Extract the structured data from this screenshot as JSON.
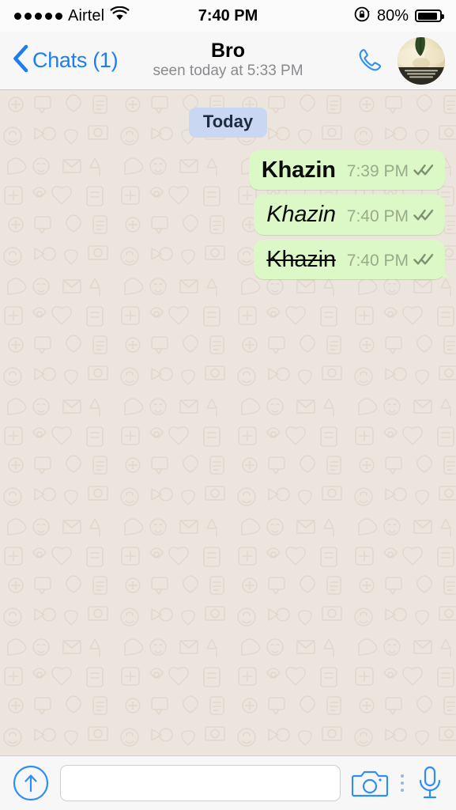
{
  "status_bar": {
    "signal_dots": 5,
    "carrier": "Airtel",
    "wifi_icon": "wifi-icon",
    "time": "7:40 PM",
    "rotation_lock_icon": "rotation-lock-icon",
    "battery_percent": "80%",
    "battery_level": 80
  },
  "nav_bar": {
    "back_icon": "chevron-left-icon",
    "back_label": "Chats (1)",
    "title": "Bro",
    "subtitle": "seen today at 5:33 PM",
    "call_icon": "phone-icon",
    "avatar_icon": "contact-avatar"
  },
  "chat": {
    "day_divider": "Today",
    "messages": [
      {
        "text": "Khazin",
        "style": "bold",
        "time": "7:39 PM",
        "status_icon": "double-check-icon",
        "tail": false
      },
      {
        "text": "Khazin",
        "style": "italic",
        "time": "7:40 PM",
        "status_icon": "double-check-icon",
        "tail": false
      },
      {
        "text": "Khazin",
        "style": "strikethrough",
        "time": "7:40 PM",
        "status_icon": "double-check-icon",
        "tail": true
      }
    ]
  },
  "input_bar": {
    "attach_icon": "arrow-up-circle-icon",
    "message_value": "",
    "message_placeholder": "",
    "camera_icon": "camera-icon",
    "more_icon": "more-vertical-icon",
    "mic_icon": "microphone-icon"
  },
  "colors": {
    "bubble_green": "#dcf8c6",
    "wallpaper": "#ece5dd",
    "accent_blue": "#1c7ef3",
    "day_pill": "#c9d7f2",
    "tick_grey": "#7f8f72",
    "time_grey": "#9aab8c"
  }
}
